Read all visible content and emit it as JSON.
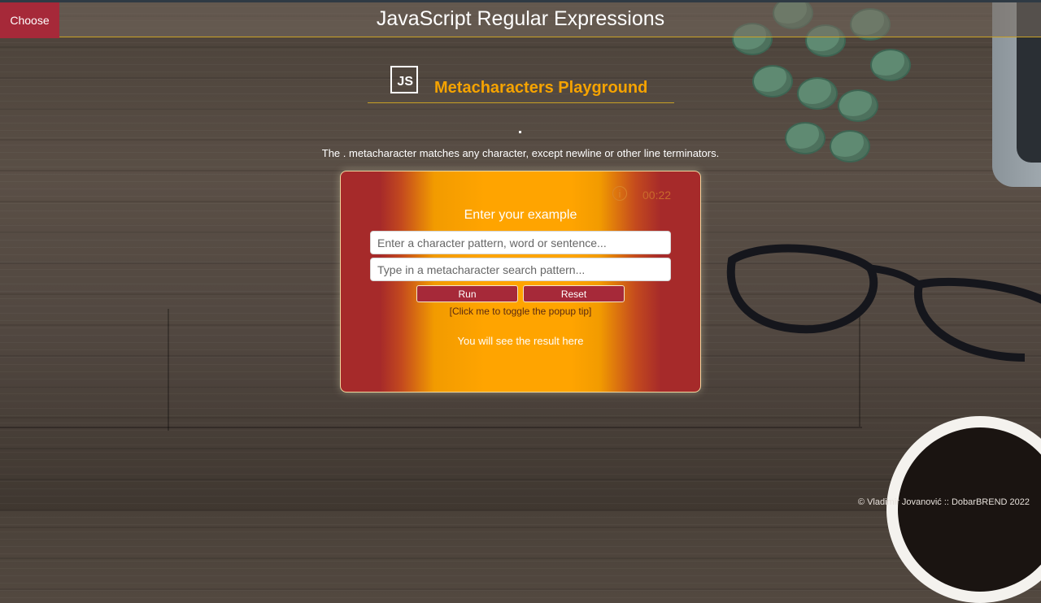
{
  "header": {
    "choose_label": "Choose",
    "title": "JavaScript Regular Expressions"
  },
  "section": {
    "logo_text": "JS",
    "title": "Metacharacters Playground",
    "description": "The . metacharacter matches any character, except newline or other line terminators."
  },
  "card": {
    "info_icon": "info-icon",
    "timer": "00:22",
    "title": "Enter your example",
    "pattern_placeholder": "Enter a character pattern, word or sentence...",
    "meta_placeholder": "Type in a metacharacter search pattern...",
    "run_label": "Run",
    "reset_label": "Reset",
    "popup_toggle": "[Click me to toggle the popup tip]",
    "result": "You will see the result here"
  },
  "footer": {
    "copyright": "© Vladimir Jovanović :: DobarBREND 2022"
  },
  "colors": {
    "accent_red": "#a62939",
    "accent_orange": "#ffa400",
    "title_orange": "#f5a300",
    "gold_line": "#c9a227"
  }
}
